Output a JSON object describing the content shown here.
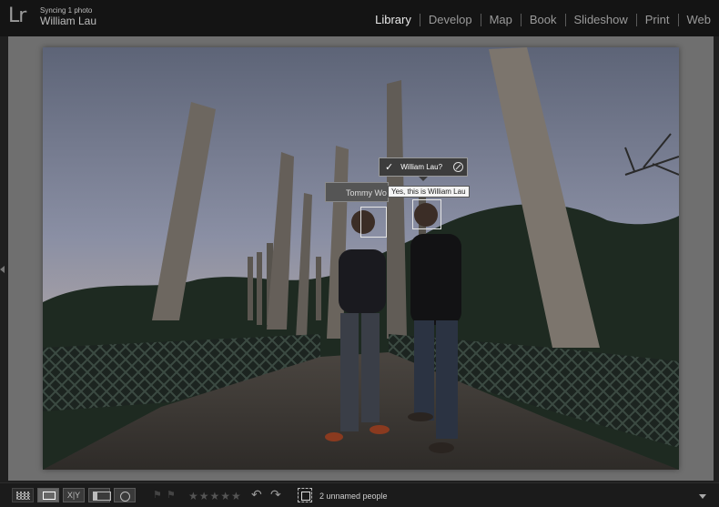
{
  "app": {
    "logo": "Lr",
    "sync_status": "Syncing 1 photo",
    "user_name": "William Lau"
  },
  "modules": [
    {
      "label": "Library",
      "active": true
    },
    {
      "label": "Develop",
      "active": false
    },
    {
      "label": "Map",
      "active": false
    },
    {
      "label": "Book",
      "active": false
    },
    {
      "label": "Slideshow",
      "active": false
    },
    {
      "label": "Print",
      "active": false
    },
    {
      "label": "Web",
      "active": false
    }
  ],
  "faces": {
    "left_label": "Tommy Wo",
    "right_label": "William Lau?",
    "tooltip": "Yes, this is William Lau"
  },
  "toolbar": {
    "stars": "★★★★★",
    "people_status": "2 unnamed people"
  },
  "colors": {
    "accent_active": "#e8e8e8",
    "panel_bg": "#1f1f1f"
  }
}
